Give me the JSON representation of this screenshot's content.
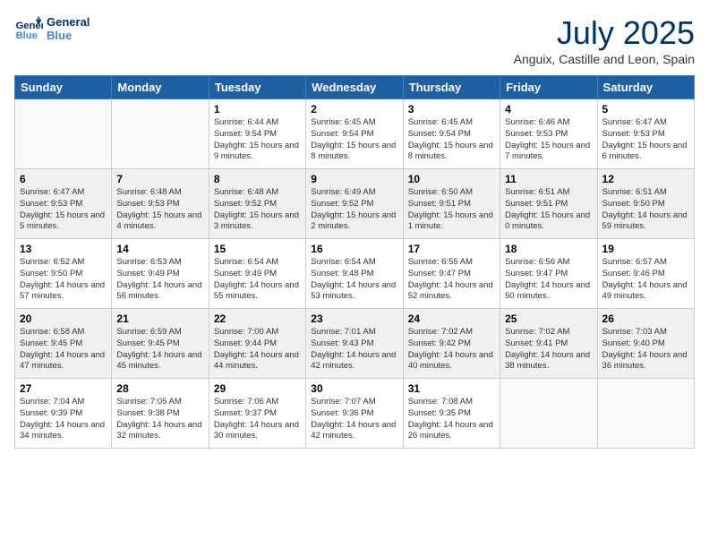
{
  "header": {
    "logo_line1": "General",
    "logo_line2": "Blue",
    "main_title": "July 2025",
    "subtitle": "Anguix, Castille and Leon, Spain"
  },
  "weekdays": [
    "Sunday",
    "Monday",
    "Tuesday",
    "Wednesday",
    "Thursday",
    "Friday",
    "Saturday"
  ],
  "weeks": [
    [
      {
        "day": "",
        "info": ""
      },
      {
        "day": "",
        "info": ""
      },
      {
        "day": "1",
        "info": "Sunrise: 6:44 AM\nSunset: 9:54 PM\nDaylight: 15 hours and 9 minutes."
      },
      {
        "day": "2",
        "info": "Sunrise: 6:45 AM\nSunset: 9:54 PM\nDaylight: 15 hours and 8 minutes."
      },
      {
        "day": "3",
        "info": "Sunrise: 6:45 AM\nSunset: 9:54 PM\nDaylight: 15 hours and 8 minutes."
      },
      {
        "day": "4",
        "info": "Sunrise: 6:46 AM\nSunset: 9:53 PM\nDaylight: 15 hours and 7 minutes."
      },
      {
        "day": "5",
        "info": "Sunrise: 6:47 AM\nSunset: 9:53 PM\nDaylight: 15 hours and 6 minutes."
      }
    ],
    [
      {
        "day": "6",
        "info": "Sunrise: 6:47 AM\nSunset: 9:53 PM\nDaylight: 15 hours and 5 minutes."
      },
      {
        "day": "7",
        "info": "Sunrise: 6:48 AM\nSunset: 9:53 PM\nDaylight: 15 hours and 4 minutes."
      },
      {
        "day": "8",
        "info": "Sunrise: 6:48 AM\nSunset: 9:52 PM\nDaylight: 15 hours and 3 minutes."
      },
      {
        "day": "9",
        "info": "Sunrise: 6:49 AM\nSunset: 9:52 PM\nDaylight: 15 hours and 2 minutes."
      },
      {
        "day": "10",
        "info": "Sunrise: 6:50 AM\nSunset: 9:51 PM\nDaylight: 15 hours and 1 minute."
      },
      {
        "day": "11",
        "info": "Sunrise: 6:51 AM\nSunset: 9:51 PM\nDaylight: 15 hours and 0 minutes."
      },
      {
        "day": "12",
        "info": "Sunrise: 6:51 AM\nSunset: 9:50 PM\nDaylight: 14 hours and 59 minutes."
      }
    ],
    [
      {
        "day": "13",
        "info": "Sunrise: 6:52 AM\nSunset: 9:50 PM\nDaylight: 14 hours and 57 minutes."
      },
      {
        "day": "14",
        "info": "Sunrise: 6:53 AM\nSunset: 9:49 PM\nDaylight: 14 hours and 56 minutes."
      },
      {
        "day": "15",
        "info": "Sunrise: 6:54 AM\nSunset: 9:49 PM\nDaylight: 14 hours and 55 minutes."
      },
      {
        "day": "16",
        "info": "Sunrise: 6:54 AM\nSunset: 9:48 PM\nDaylight: 14 hours and 53 minutes."
      },
      {
        "day": "17",
        "info": "Sunrise: 6:55 AM\nSunset: 9:47 PM\nDaylight: 14 hours and 52 minutes."
      },
      {
        "day": "18",
        "info": "Sunrise: 6:56 AM\nSunset: 9:47 PM\nDaylight: 14 hours and 50 minutes."
      },
      {
        "day": "19",
        "info": "Sunrise: 6:57 AM\nSunset: 9:46 PM\nDaylight: 14 hours and 49 minutes."
      }
    ],
    [
      {
        "day": "20",
        "info": "Sunrise: 6:58 AM\nSunset: 9:45 PM\nDaylight: 14 hours and 47 minutes."
      },
      {
        "day": "21",
        "info": "Sunrise: 6:59 AM\nSunset: 9:45 PM\nDaylight: 14 hours and 45 minutes."
      },
      {
        "day": "22",
        "info": "Sunrise: 7:00 AM\nSunset: 9:44 PM\nDaylight: 14 hours and 44 minutes."
      },
      {
        "day": "23",
        "info": "Sunrise: 7:01 AM\nSunset: 9:43 PM\nDaylight: 14 hours and 42 minutes."
      },
      {
        "day": "24",
        "info": "Sunrise: 7:02 AM\nSunset: 9:42 PM\nDaylight: 14 hours and 40 minutes."
      },
      {
        "day": "25",
        "info": "Sunrise: 7:02 AM\nSunset: 9:41 PM\nDaylight: 14 hours and 38 minutes."
      },
      {
        "day": "26",
        "info": "Sunrise: 7:03 AM\nSunset: 9:40 PM\nDaylight: 14 hours and 36 minutes."
      }
    ],
    [
      {
        "day": "27",
        "info": "Sunrise: 7:04 AM\nSunset: 9:39 PM\nDaylight: 14 hours and 34 minutes."
      },
      {
        "day": "28",
        "info": "Sunrise: 7:05 AM\nSunset: 9:38 PM\nDaylight: 14 hours and 32 minutes."
      },
      {
        "day": "29",
        "info": "Sunrise: 7:06 AM\nSunset: 9:37 PM\nDaylight: 14 hours and 30 minutes."
      },
      {
        "day": "30",
        "info": "Sunrise: 7:07 AM\nSunset: 9:36 PM\nDaylight: 14 hours and 42 minutes."
      },
      {
        "day": "31",
        "info": "Sunrise: 7:08 AM\nSunset: 9:35 PM\nDaylight: 14 hours and 26 minutes."
      },
      {
        "day": "",
        "info": ""
      },
      {
        "day": "",
        "info": ""
      }
    ]
  ]
}
